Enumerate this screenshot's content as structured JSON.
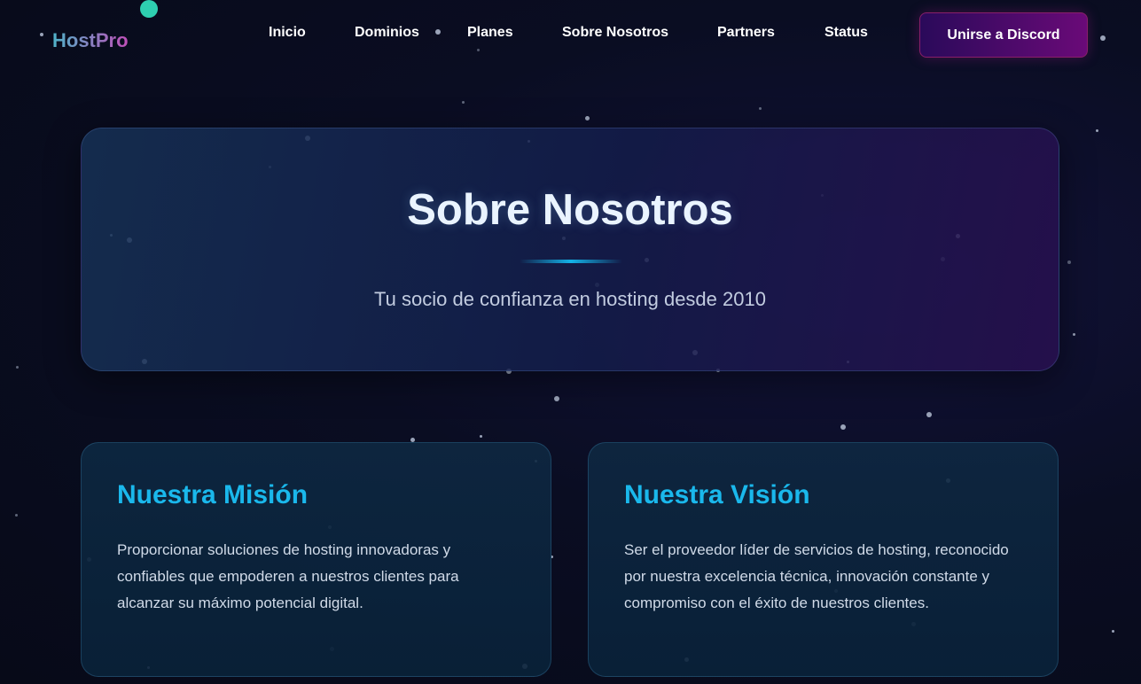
{
  "header": {
    "logo": "HostPro",
    "nav": [
      "Inicio",
      "Dominios",
      "Planes",
      "Sobre Nosotros",
      "Partners",
      "Status"
    ],
    "cta_label": "Unirse a Discord"
  },
  "hero": {
    "title": "Sobre Nosotros",
    "subtitle": "Tu socio de confianza en hosting desde 2010"
  },
  "cards": [
    {
      "title": "Nuestra Misión",
      "text": "Proporcionar soluciones de hosting innovadoras y confiables que empoderen a nuestros clientes para alcanzar su máximo potencial digital."
    },
    {
      "title": "Nuestra Visión",
      "text": "Ser el proveedor líder de servicios de hosting, reconocido por nuestra excelencia técnica, innovación constante y compromiso con el éxito de nuestros clientes."
    }
  ],
  "colors": {
    "accent": "#1ab8ec",
    "cta": "#6a0a78",
    "logo_dot": "#2ecfb0"
  }
}
